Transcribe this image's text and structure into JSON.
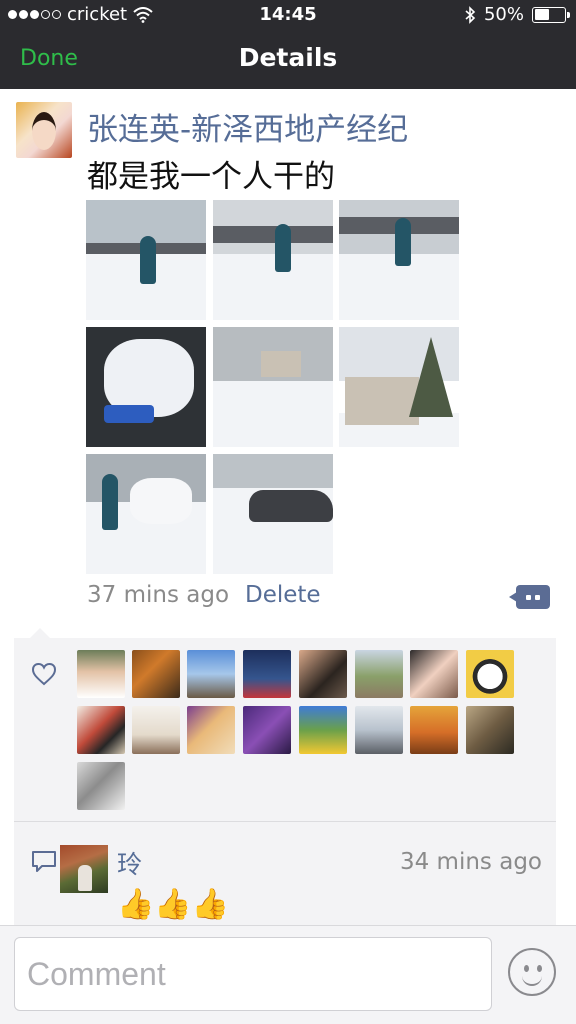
{
  "status_bar": {
    "carrier": "cricket",
    "time": "14:45",
    "battery": "50%",
    "signal_dots_filled": 3,
    "signal_dots_total": 5,
    "battery_level": 0.5
  },
  "nav": {
    "done_label": "Done",
    "title": "Details"
  },
  "post": {
    "author": "张连英-新泽西地产经纪",
    "text": "都是我一个人干的",
    "photo_count": 8,
    "time": "37 mins ago",
    "delete_label": "Delete"
  },
  "likes": {
    "liker_count": 17
  },
  "comments": [
    {
      "author": "玲",
      "time": "34 mins ago",
      "text": "👍👍👍"
    }
  ],
  "comment_bar": {
    "placeholder": "Comment"
  },
  "colors": {
    "nav_background": "#2b2b2f",
    "done_green": "#2fbd4a",
    "link_blue": "#566d97",
    "likes_background": "#f3f3f5"
  }
}
